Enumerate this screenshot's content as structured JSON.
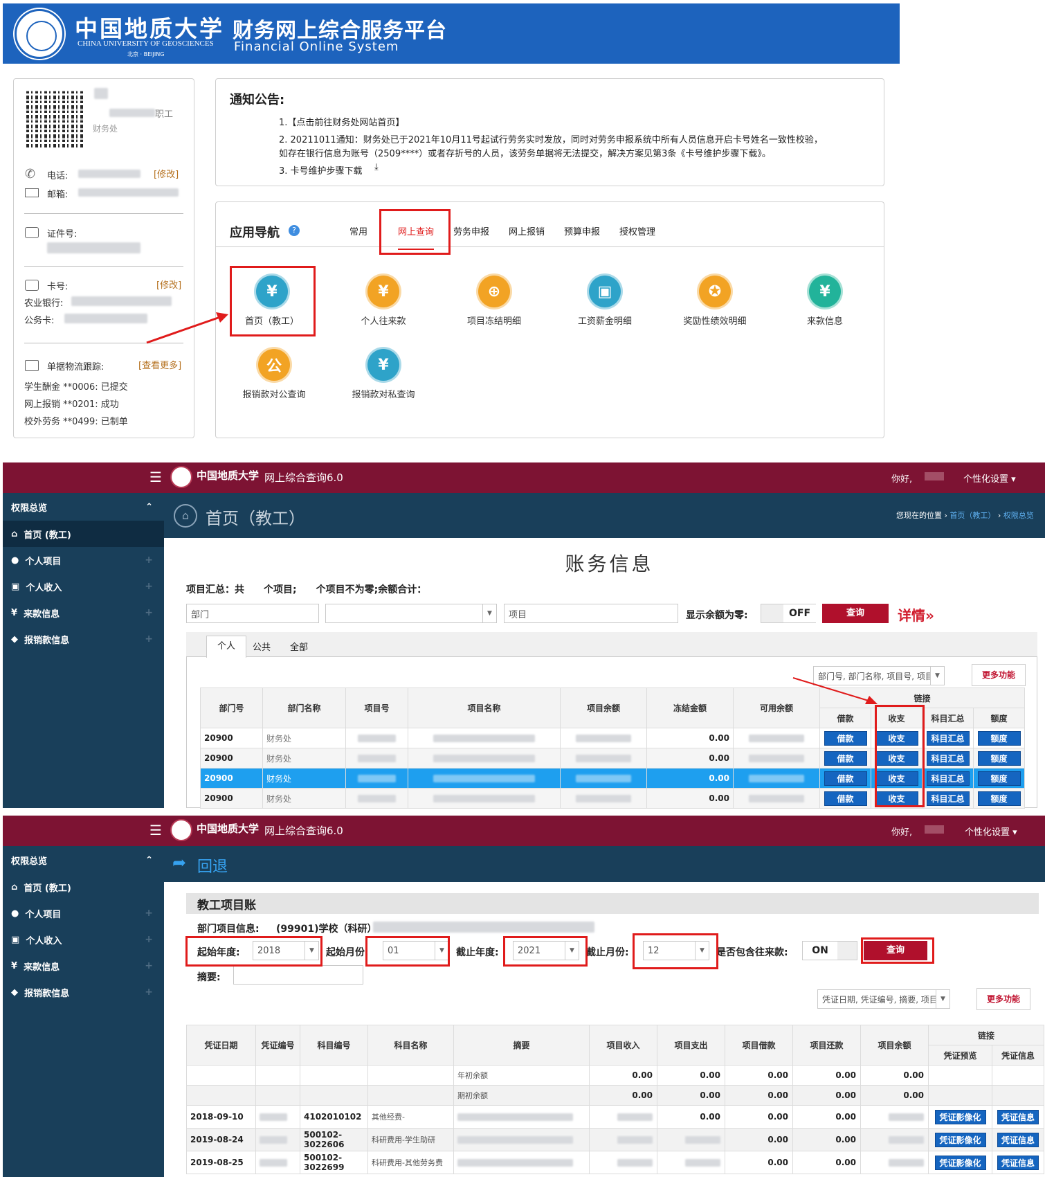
{
  "s1": {
    "univ_cn": "中国地质大学",
    "univ_en": "CHINA UNIVERSITY OF GEOSCIENCES",
    "univ_en2": "北京 · BEIJING",
    "title": "财务网上综合服务平台",
    "subtitle": "Financial Online System",
    "profile": {
      "role": "职工",
      "dept": "财务处",
      "phone_label": "电话:",
      "email_label": "邮箱:",
      "modify": "[修改]",
      "id_label": "证件号:",
      "card_label": "卡号:",
      "card_modify": "[修改]",
      "bank_label": "农业银行:",
      "official_label": "公务卡:",
      "track_label": "单据物流跟踪:",
      "track_more": "[查看更多]",
      "tracks": [
        "学生酬金 **0006: 已提交",
        "网上报销 **0201: 成功",
        "校外劳务 **0499: 已制单"
      ]
    },
    "notice": {
      "title": "通知公告:",
      "items": [
        "1.【点击前往财务处网站首页】",
        "2. 20211011通知：财务处已于2021年10月11号起试行劳务实时发放，同时对劳务申报系统中所有人员信息开启卡号姓名一致性校验，",
        "如存在银行信息为账号（2509****）或者存折号的人员，该劳务单据将无法提交，解决方案见第3条《卡号维护步骤下载》。",
        "3. 卡号维护步骤下载"
      ]
    },
    "nav": {
      "title": "应用导航",
      "help": "?",
      "tabs": [
        "常用",
        "网上查询",
        "劳务申报",
        "网上报销",
        "预算申报",
        "授权管理"
      ],
      "items": [
        {
          "label": "首页（教工）",
          "icon": "cash-icon",
          "color": "#2ea3c9"
        },
        {
          "label": "个人往来款",
          "icon": "money-bag-icon",
          "color": "#f2a324"
        },
        {
          "label": "项目冻结明细",
          "icon": "lock-icon",
          "color": "#f2a324"
        },
        {
          "label": "工资薪金明细",
          "icon": "wallet-icon",
          "color": "#2ea3c9"
        },
        {
          "label": "奖励性绩效明细",
          "icon": "medal-icon",
          "color": "#f2a324"
        },
        {
          "label": "来款信息",
          "icon": "yen-shield-icon",
          "color": "#22b39a"
        },
        {
          "label": "报销款对公查询",
          "icon": "clipboard-icon",
          "color": "#f2a324"
        },
        {
          "label": "报销款对私查询",
          "icon": "receipt-icon",
          "color": "#2ea3c9"
        }
      ]
    }
  },
  "topbar": {
    "univ": "中国地质大学",
    "app": "网上综合查询6.0",
    "hello": "你好,",
    "settings": "个性化设置"
  },
  "sidebar": {
    "group": "权限总览",
    "items": [
      {
        "label": "首页 (教工)",
        "icon": "home-icon"
      },
      {
        "label": "个人项目",
        "icon": "user-icon"
      },
      {
        "label": "个人收入",
        "icon": "money-icon"
      },
      {
        "label": "来款信息",
        "icon": "yen-icon"
      },
      {
        "label": "报销款信息",
        "icon": "tag-icon"
      }
    ]
  },
  "s2": {
    "page_title": "首页（教工）",
    "breadcrumb_label": "您现在的位置",
    "crumb1": "首页（教工）",
    "crumb2": "权限总览",
    "heading": "账务信息",
    "summary": "项目汇总：共　　个项目;　　个项目不为零;余额合计：",
    "dept_placeholder": "部门",
    "project_placeholder": "项目",
    "show_zero_label": "显示余额为零:",
    "toggle": "OFF",
    "query": "查询",
    "detail": "详情»",
    "tabs": [
      "个人",
      "公共",
      "全部"
    ],
    "search_fields": "部门号, 部门名称, 项目号, 项目",
    "more": "更多功能",
    "headers": [
      "部门号",
      "部门名称",
      "项目号",
      "项目名称",
      "项目余额",
      "冻结金额",
      "可用余额"
    ],
    "link_header": "链接",
    "link_cols": [
      "借款",
      "收支",
      "科目汇总",
      "额度"
    ],
    "rows": [
      {
        "dept_no": "20900",
        "dept": "财务处",
        "frozen": "0.00"
      },
      {
        "dept_no": "20900",
        "dept": "财务处",
        "frozen": "0.00"
      },
      {
        "dept_no": "20900",
        "dept": "财务处",
        "frozen": "0.00"
      },
      {
        "dept_no": "20900",
        "dept": "财务处",
        "frozen": "0.00"
      }
    ],
    "btns": [
      "借款",
      "收支",
      "科目汇总",
      "额度"
    ]
  },
  "s3": {
    "back": "回退",
    "panel_title": "教工项目账",
    "dept_info_label": "部门项目信息:",
    "dept_info": "(99901)学校（科研）",
    "start_year_label": "起始年度:",
    "start_year": "2018",
    "start_month_label": "起始月份:",
    "start_month": "01",
    "end_year_label": "截止年度:",
    "end_year": "2021",
    "end_month_label": "截止月份:",
    "end_month": "12",
    "include_label": "是否包含往来款:",
    "toggle": "ON",
    "query": "查询",
    "summary_label": "摘要:",
    "search_fields": "凭证日期, 凭证编号, 摘要, 项目",
    "more": "更多功能",
    "headers": [
      "凭证日期",
      "凭证编号",
      "科目编号",
      "科目名称",
      "摘要",
      "项目收入",
      "项目支出",
      "项目借款",
      "项目还款",
      "项目余额"
    ],
    "link_header": "链接",
    "link_cols": [
      "凭证预览",
      "凭证信息"
    ],
    "rows": [
      {
        "date": "",
        "no": "",
        "subject_no": "",
        "subject": "",
        "summary": "年初余额",
        "v": [
          "0.00",
          "0.00",
          "0.00",
          "0.00",
          "0.00"
        ],
        "btn": false
      },
      {
        "date": "",
        "no": "",
        "subject_no": "",
        "subject": "",
        "summary": "期初余额",
        "v": [
          "0.00",
          "0.00",
          "0.00",
          "0.00",
          "0.00"
        ],
        "btn": false
      },
      {
        "date": "2018-09-10",
        "no": "",
        "subject_no": "4102010102",
        "subject": "其他经费-",
        "summary": "",
        "v": [
          "",
          "0.00",
          "0.00",
          "0.00",
          ""
        ],
        "btn": true
      },
      {
        "date": "2019-08-24",
        "no": "",
        "subject_no": "500102-3022606",
        "subject": "科研费用-学生助研",
        "summary": "",
        "v": [
          "",
          "",
          "0.00",
          "0.00",
          ""
        ],
        "btn": true
      },
      {
        "date": "2019-08-25",
        "no": "",
        "subject_no": "500102-3022699",
        "subject": "科研费用-其他劳务费",
        "summary": "",
        "v": [
          "",
          "",
          "0.00",
          "0.00",
          ""
        ],
        "btn": true
      }
    ],
    "btns": [
      "凭证影像化",
      "凭证信息"
    ]
  }
}
